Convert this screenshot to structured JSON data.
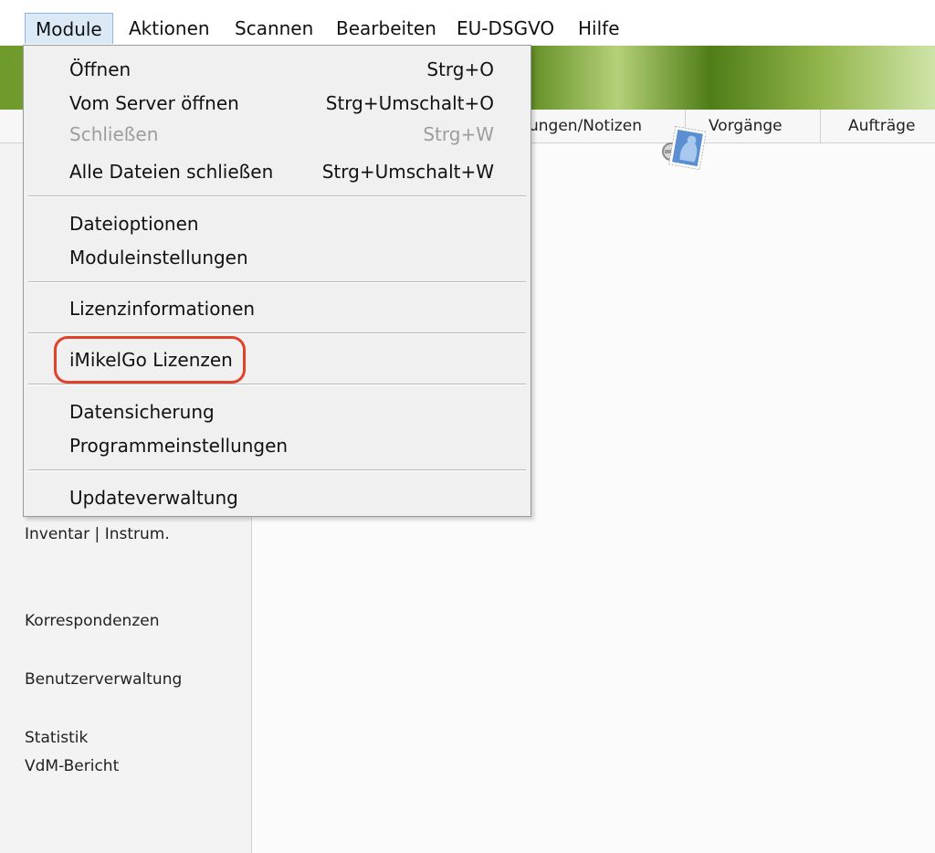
{
  "menubar": {
    "items": [
      "Module",
      "Aktionen",
      "Scannen",
      "Bearbeiten",
      "EU-DSGVO",
      "Hilfe"
    ],
    "active_index": 0
  },
  "tabs": [
    "ungen/Notizen",
    "Vorgänge",
    "Aufträge"
  ],
  "dropdown": {
    "items": [
      {
        "label": "Öffnen",
        "shortcut": "Strg+O",
        "disabled": false
      },
      {
        "label": "Vom Server öffnen",
        "shortcut": "Strg+Umschalt+O",
        "disabled": false
      },
      {
        "label": "Schließen",
        "shortcut": "Strg+W",
        "disabled": true
      },
      {
        "label": "Alle Dateien schließen",
        "shortcut": "Strg+Umschalt+W",
        "disabled": false
      },
      {
        "label": "Dateioptionen",
        "shortcut": "",
        "disabled": false
      },
      {
        "label": "Moduleinstellungen",
        "shortcut": "",
        "disabled": false
      },
      {
        "label": "Lizenzinformationen",
        "shortcut": "",
        "disabled": false
      },
      {
        "label": "iMikelGo Lizenzen",
        "shortcut": "",
        "disabled": false,
        "highlighted": true
      },
      {
        "label": "Datensicherung",
        "shortcut": "",
        "disabled": false
      },
      {
        "label": "Programmeinstellungen",
        "shortcut": "",
        "disabled": false
      },
      {
        "label": "Updateverwaltung",
        "shortcut": "",
        "disabled": false
      }
    ]
  },
  "sidebar": {
    "links": [
      "Inventar | Instrum.",
      "Korrespondenzen",
      "Benutzerverwaltung",
      "Statistik",
      "VdM-Bericht"
    ]
  },
  "colors": {
    "highlight_ring": "#e0412a",
    "active_menu_bg": "#dbe9f7"
  }
}
